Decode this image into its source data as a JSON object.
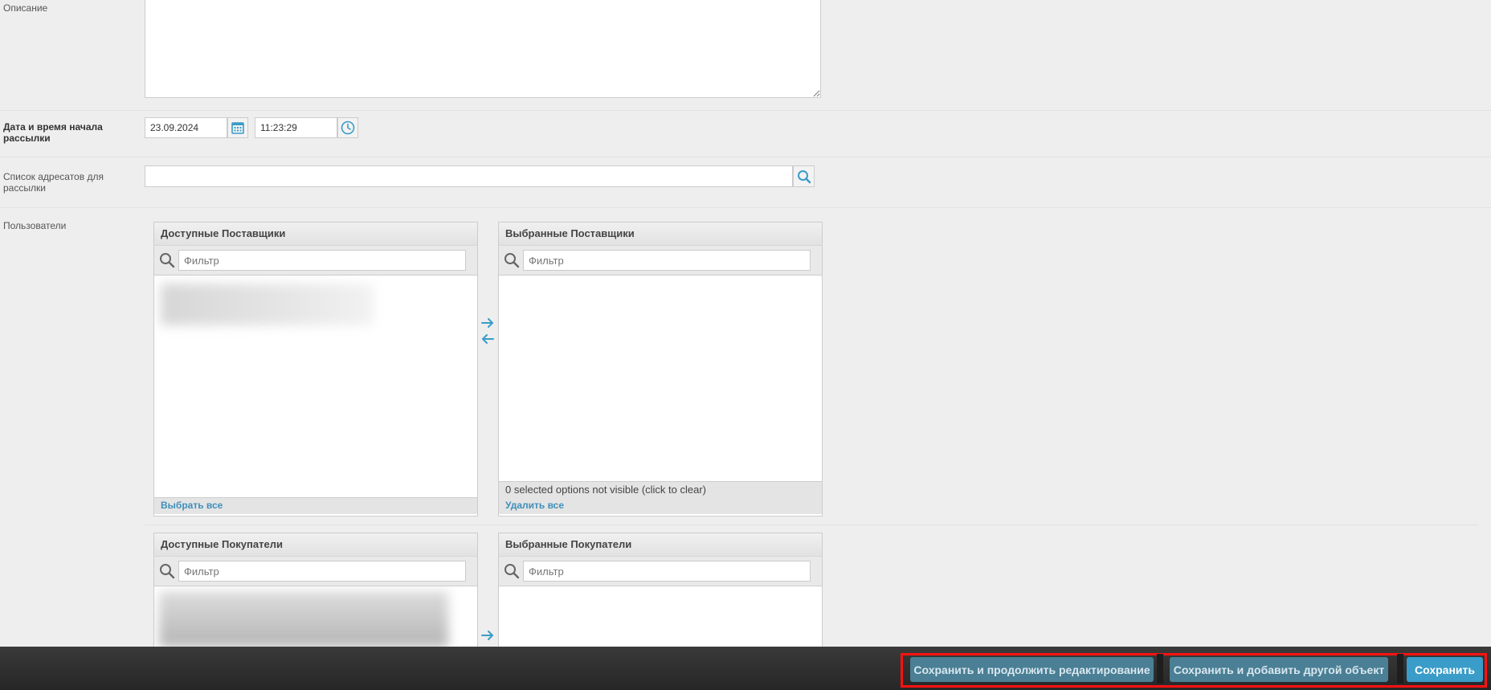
{
  "form": {
    "description": {
      "label": "Описание",
      "value": ""
    },
    "start_datetime": {
      "label_line1": "Дата и время начала",
      "label_line2": "рассылки",
      "date": "23.09.2024",
      "time": "11:23:29"
    },
    "recipients_list": {
      "label_line1": "Список адресатов для",
      "label_line2": "рассылки",
      "value": ""
    },
    "users_label": "Пользователи"
  },
  "suppliers": {
    "available_title": "Доступные Поставщики",
    "selected_title": "Выбранные Поставщики",
    "filter_placeholder": "Фильтр",
    "select_all": "Выбрать все",
    "remove_all": "Удалить все",
    "hidden_notice": "0 selected options not visible (click to clear)"
  },
  "buyers": {
    "available_title": "Доступные Покупатели",
    "selected_title": "Выбранные Покупатели",
    "filter_placeholder": "Фильтр"
  },
  "actions": {
    "save_continue": "Сохранить и продолжить редактирование",
    "save_add": "Сохранить и добавить другой объект",
    "save": "Сохранить"
  },
  "colors": {
    "accent": "#3a9cc8",
    "link": "#3f8fba",
    "highlight_frame": "#ff1212",
    "bar": "#2c2c2c"
  },
  "icons": {
    "calendar": "calendar-icon",
    "clock": "clock-icon",
    "search": "search-icon",
    "add": "arrow-right-icon",
    "remove": "arrow-left-icon"
  }
}
